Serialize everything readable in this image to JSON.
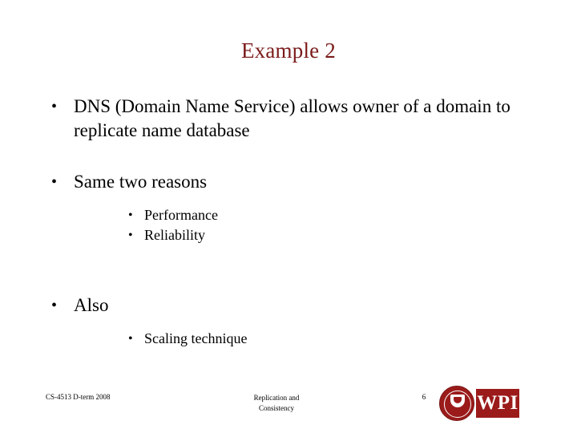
{
  "slide": {
    "title": "Example 2",
    "bullets": [
      {
        "level": 1,
        "text": "DNS (Domain Name Service) allows owner of a domain to replicate name database",
        "bullet_glyph": "•"
      },
      {
        "level": 1,
        "text": "Same two reasons",
        "bullet_glyph": "•"
      },
      {
        "level": 2,
        "text": "Performance",
        "bullet_glyph": "•"
      },
      {
        "level": 2,
        "text": "Reliability",
        "bullet_glyph": "•"
      },
      {
        "level": 1,
        "text": "Also",
        "bullet_glyph": "•"
      },
      {
        "level": 2,
        "text": "Scaling technique",
        "bullet_glyph": "•"
      }
    ]
  },
  "footer": {
    "course": "CS-4513 D-term 2008",
    "topic_line1": "Replication and",
    "topic_line2": "Consistency",
    "page_number": "6",
    "logo_text": "WPI",
    "logo_color": "#9b1b1b"
  },
  "theme": {
    "title_color": "#7b1b1b",
    "text_color": "#000000",
    "background": "#ffffff"
  }
}
